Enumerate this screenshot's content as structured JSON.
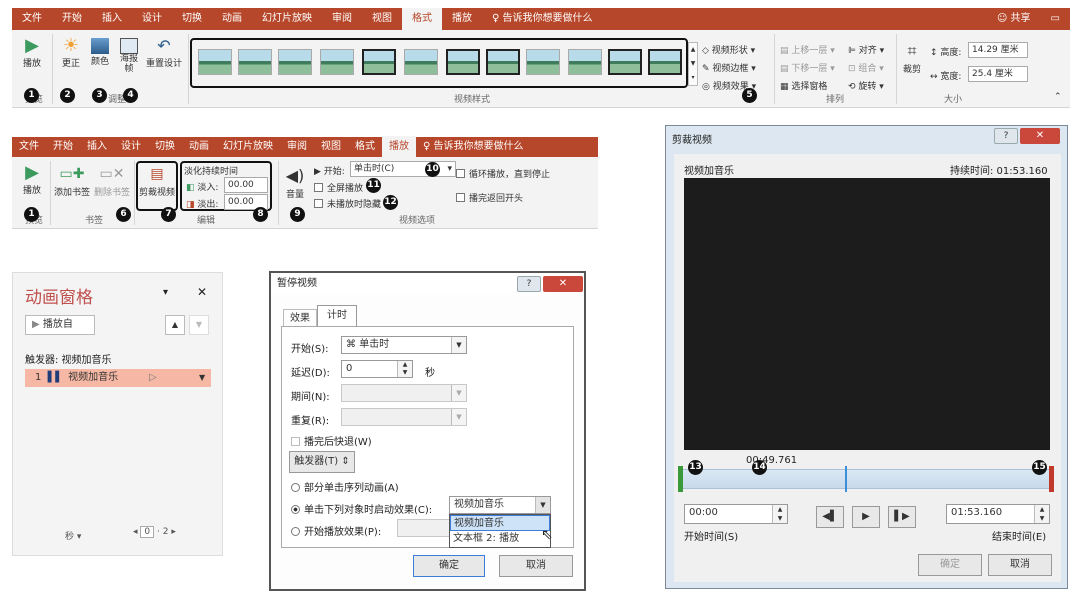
{
  "top_ribbon": {
    "tabs": [
      "文件",
      "开始",
      "插入",
      "设计",
      "切换",
      "动画",
      "幻灯片放映",
      "审阅",
      "视图",
      "格式",
      "播放"
    ],
    "active_tab": "格式",
    "tell_me": "告诉我你想要做什么",
    "share": "共享",
    "buttons": {
      "play": "播放",
      "correct": "更正",
      "color": "颜色",
      "poster": "海报帧",
      "reset": "重置设计"
    },
    "adjust_group": "调整",
    "preview_group": "预览",
    "side_buttons": {
      "shape": "视频形状",
      "border": "视频边框",
      "effect": "视频效果"
    },
    "styles_group": "视频样式",
    "arrange": {
      "forward": "上移一层",
      "backward": "下移一层",
      "pane": "选择窗格",
      "align": "对齐",
      "group": "组合",
      "rotate": "旋转",
      "label": "排列"
    },
    "size": {
      "crop": "裁剪",
      "height_label": "高度:",
      "height": "14.29 厘米",
      "width_label": "宽度:",
      "width": "25.4 厘米",
      "label": "大小"
    }
  },
  "bottom_ribbon": {
    "tabs": [
      "文件",
      "开始",
      "插入",
      "设计",
      "切换",
      "动画",
      "幻灯片放映",
      "审阅",
      "视图",
      "格式",
      "播放"
    ],
    "active_tab": "播放",
    "tell_me": "告诉我你想要做什么",
    "buttons": {
      "play": "播放",
      "add_bookmark": "添加书签",
      "remove_bookmark": "删除书签",
      "trim": "剪裁视频",
      "volume": "音量"
    },
    "groups": {
      "preview": "预览",
      "bookmarks": "书签",
      "editing": "编辑",
      "video_options": "视频选项"
    },
    "fade": {
      "title": "淡化持续时间",
      "in_label": "淡入:",
      "in": "00.00",
      "out_label": "淡出:",
      "out": "00.00"
    },
    "options": {
      "start_label": "开始:",
      "start_value": "单击时(C)",
      "fullscreen": "全屏播放",
      "hide": "未播放时隐藏",
      "loop": "循环播放，直到停止",
      "rewind": "播完返回开头"
    }
  },
  "callouts": [
    "1",
    "2",
    "3",
    "4",
    "5",
    "1",
    "6",
    "7",
    "8",
    "9",
    "10",
    "11",
    "12",
    "13",
    "14",
    "15"
  ],
  "anim_pane": {
    "title": "动画窗格",
    "play_from": "播放自",
    "trigger": "触发器: 视频加音乐",
    "item_num": "1",
    "item": "视频加音乐",
    "footer_seconds": "秒",
    "page_left": "0",
    "page_right": "2"
  },
  "pause_dialog": {
    "title": "暂停视频",
    "tabs": [
      "效果",
      "计时"
    ],
    "start_label": "开始(S):",
    "start_value": "单击时",
    "delay_label": "延迟(D):",
    "delay_value": "0",
    "delay_unit": "秒",
    "period_label": "期间(N):",
    "repeat_label": "重复(R):",
    "rewind": "播完后快退(W)",
    "trigger_btn": "触发器(T)",
    "opt1": "部分单击序列动画(A)",
    "opt2": "单击下列对象时启动效果(C):",
    "opt2_value": "视频加音乐",
    "opt3": "开始播放效果(P):",
    "dropdown": [
      "视频加音乐",
      "文本框 2: 播放"
    ],
    "ok": "确定",
    "cancel": "取消"
  },
  "trim_dialog": {
    "title": "剪裁视频",
    "video_name": "视频加音乐",
    "duration": "持续时间: 01:53.160",
    "marker": "00:49.761",
    "start_time": "00:00",
    "start_label": "开始时间(S)",
    "end_time": "01:53.160",
    "end_label": "结束时间(E)",
    "ok": "确定",
    "cancel": "取消",
    "progress": 0.44
  },
  "colors": {
    "accent": "#b7472a",
    "pane_title": "#c0504d",
    "highlight": "#f6b8a4"
  }
}
